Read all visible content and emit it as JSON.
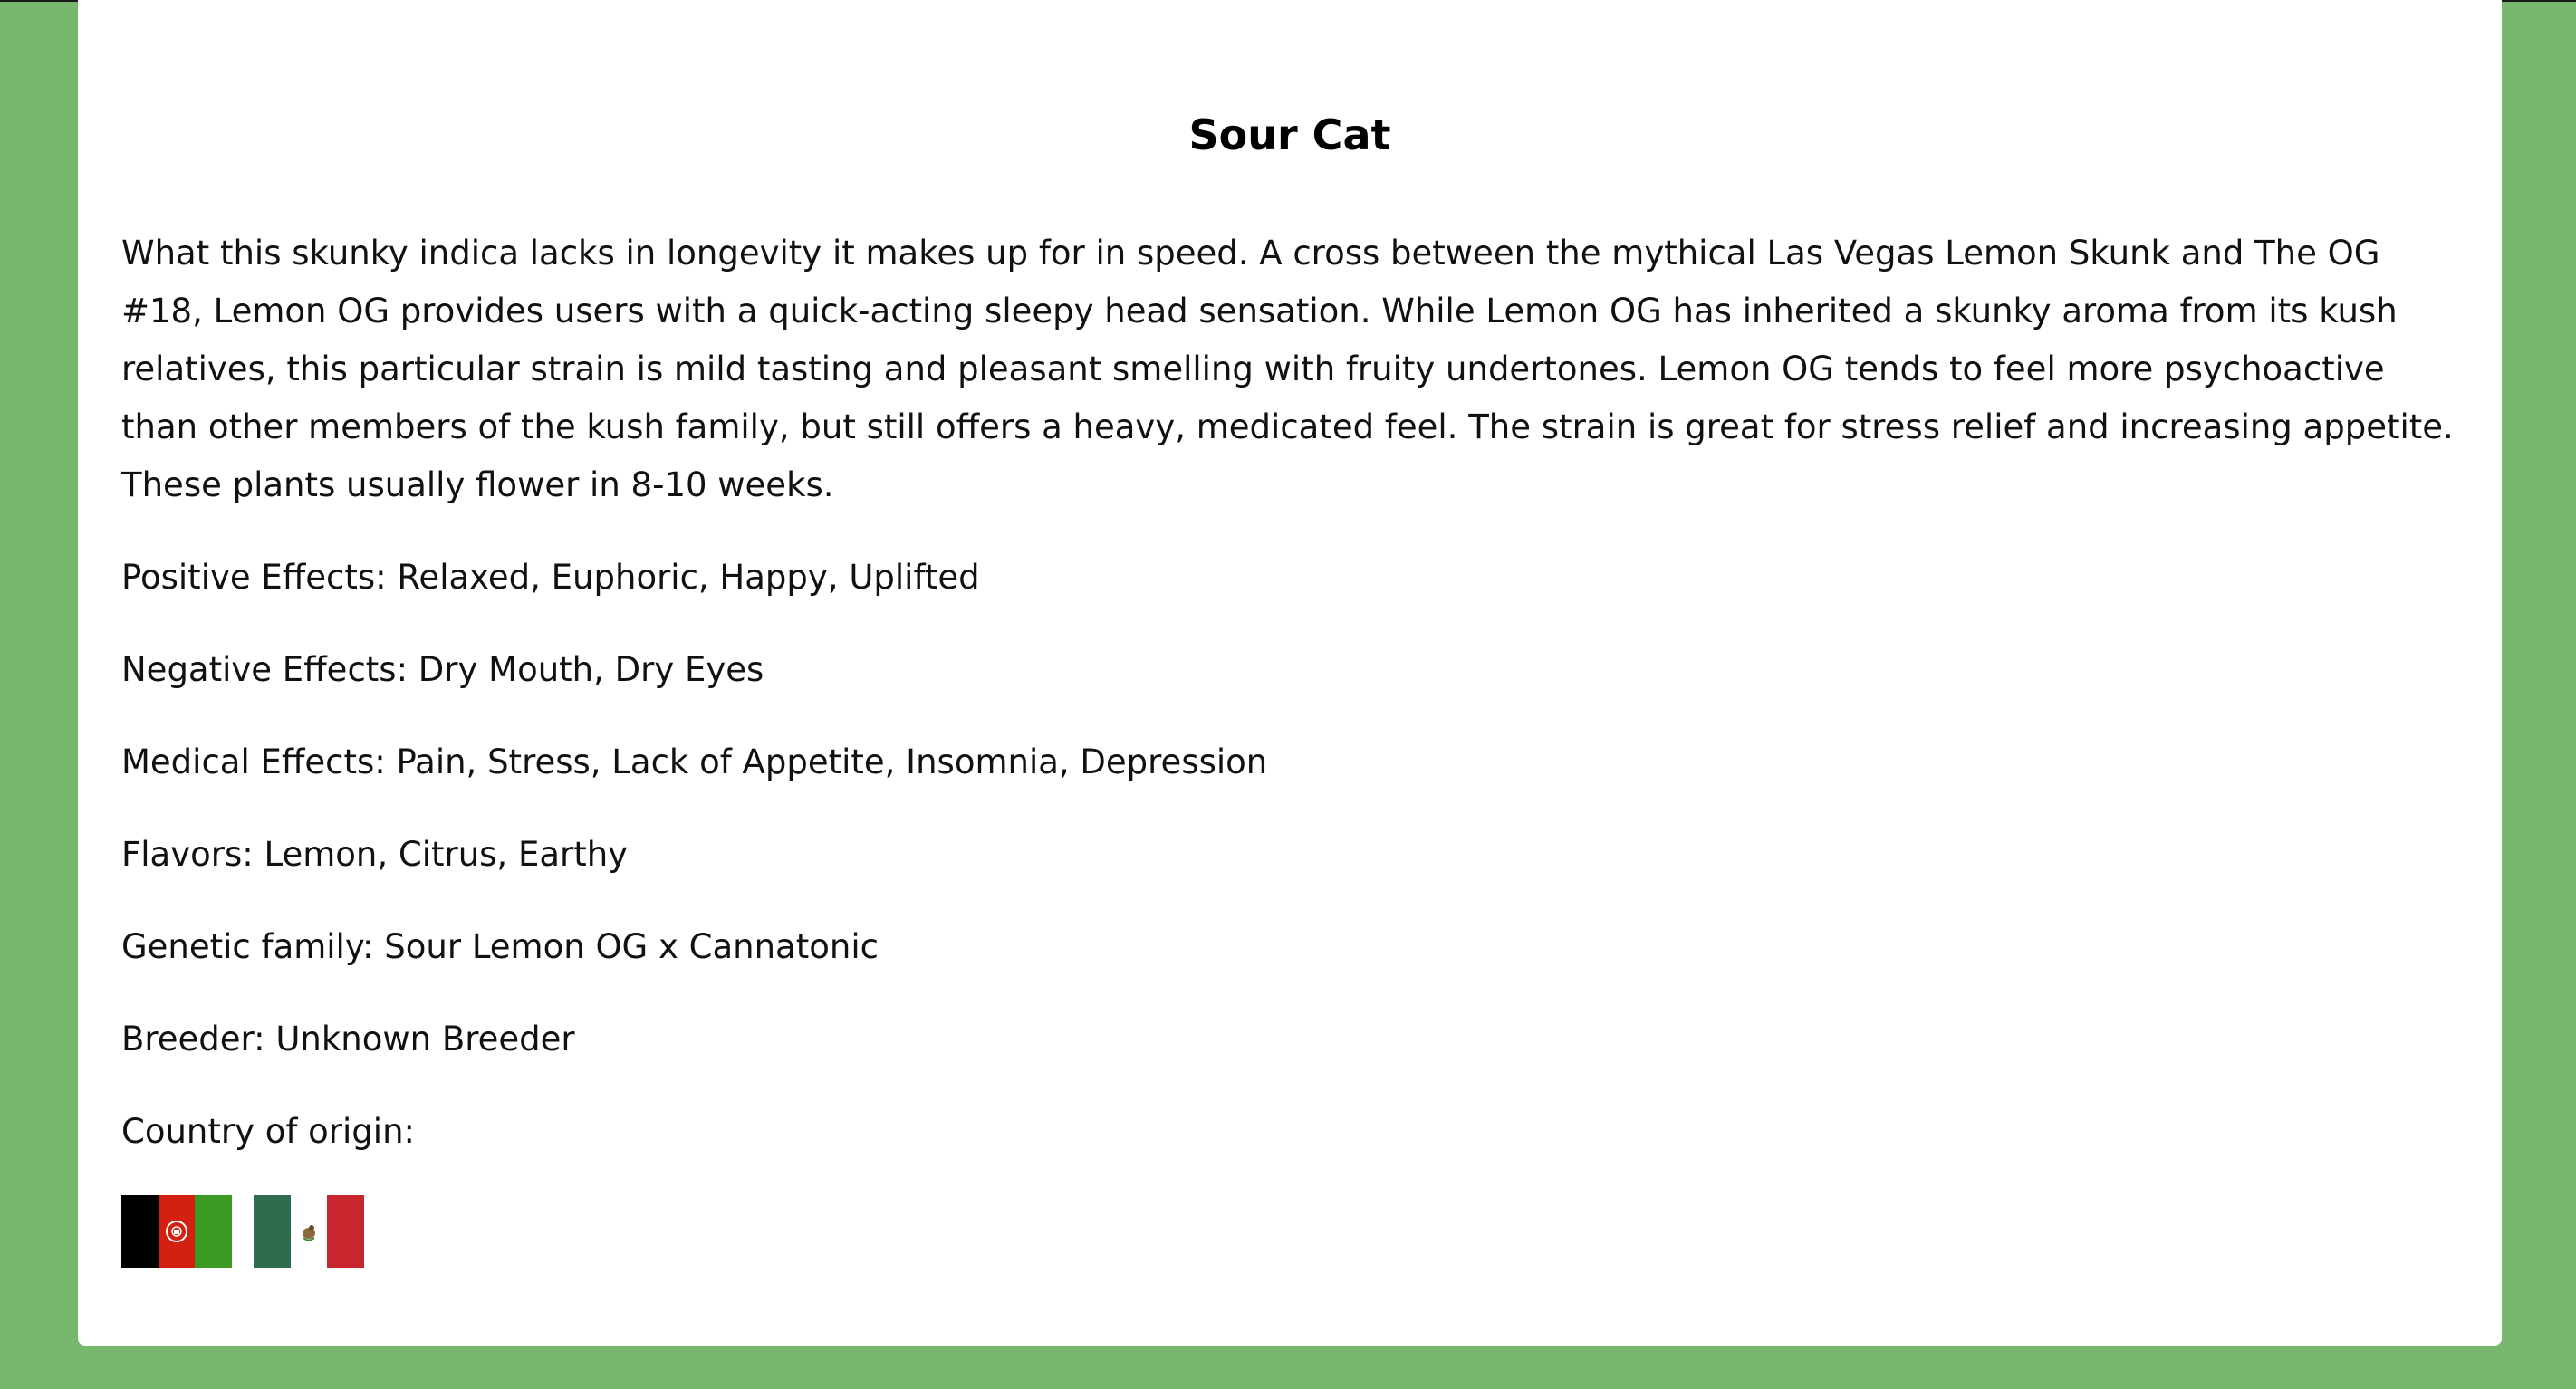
{
  "strain": {
    "title": "Sour Cat",
    "description": "What this skunky indica lacks in longevity it makes up for in speed. A cross between the mythical Las Vegas Lemon Skunk and The OG #18, Lemon OG provides users with a quick-acting sleepy head sensation. While Lemon OG has inherited a skunky aroma from its kush relatives, this particular strain is mild tasting and pleasant smelling with fruity undertones. Lemon OG tends to feel more psychoactive than other members of the kush family, but still offers a heavy, medicated feel. The strain is great for stress relief and increasing appetite. These plants usually flower in 8-10 weeks.",
    "positive_effects": "Positive Effects: Relaxed, Euphoric, Happy, Uplifted",
    "negative_effects": "Negative Effects: Dry Mouth, Dry Eyes",
    "medical_effects": "Medical Effects: Pain, Stress, Lack of Appetite, Insomnia, Depression",
    "flavors": "Flavors: Lemon, Citrus, Earthy",
    "genetic_family": "Genetic family: Sour Lemon OG x Cannatonic",
    "breeder": "Breeder: Unknown Breeder",
    "country_label": "Country of origin:"
  },
  "flags": [
    {
      "name": "afghanistan-flag",
      "colors": [
        "#000000",
        "#d32011",
        "#3b9a24"
      ]
    },
    {
      "name": "mexico-flag",
      "colors": [
        "#2f6b4f",
        "#ffffff",
        "#c8262f"
      ]
    }
  ],
  "colors": {
    "background": "#78b86e",
    "card": "#ffffff"
  }
}
